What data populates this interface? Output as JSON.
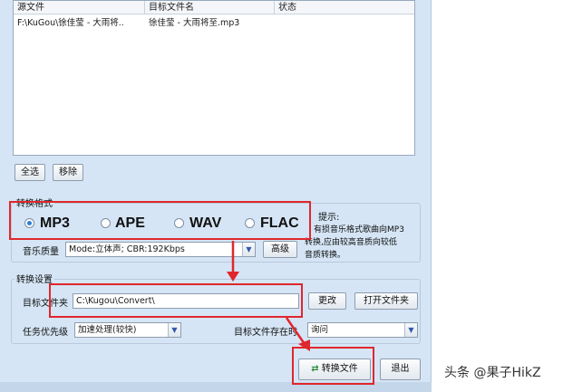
{
  "file_list": {
    "columns": [
      "源文件",
      "目标文件名",
      "状态"
    ],
    "rows": [
      {
        "source": "F:\\KuGou\\徐佳莹 - 大雨将..",
        "target": "徐佳莹 - 大雨将至.mp3",
        "status": ""
      }
    ]
  },
  "list_actions": {
    "select_all": "全选",
    "remove": "移除"
  },
  "format_section": {
    "title": "转换格式",
    "options": [
      "MP3",
      "APE",
      "WAV",
      "FLAC"
    ],
    "selected": "MP3",
    "hint_title": "提示:",
    "hint_text": [
      "有损音乐格式歌曲向MP3",
      "转换,应由较高音质向较低",
      "音质转换。"
    ],
    "quality_label": "音乐质量",
    "quality_value": "Mode:立体声; CBR:192Kbps",
    "advanced_button": "高级"
  },
  "convert_settings": {
    "title": "转换设置",
    "target_folder_label": "目标文件夹",
    "target_folder_value": "C:\\Kugou\\Convert\\",
    "change_button": "更改",
    "open_folder_button": "打开文件夹",
    "priority_label": "任务优先级",
    "priority_value": "加速处理(较快)",
    "exists_label": "目标文件存在时",
    "exists_value": "询问"
  },
  "footer": {
    "convert_button": "转换文件",
    "exit_button": "退出"
  },
  "watermark": "头条 @果子HikZ",
  "colors": {
    "highlight": "#e0272d",
    "dialog_bg": "#d5e5f5",
    "radio_selected": "#2c7fd8"
  }
}
